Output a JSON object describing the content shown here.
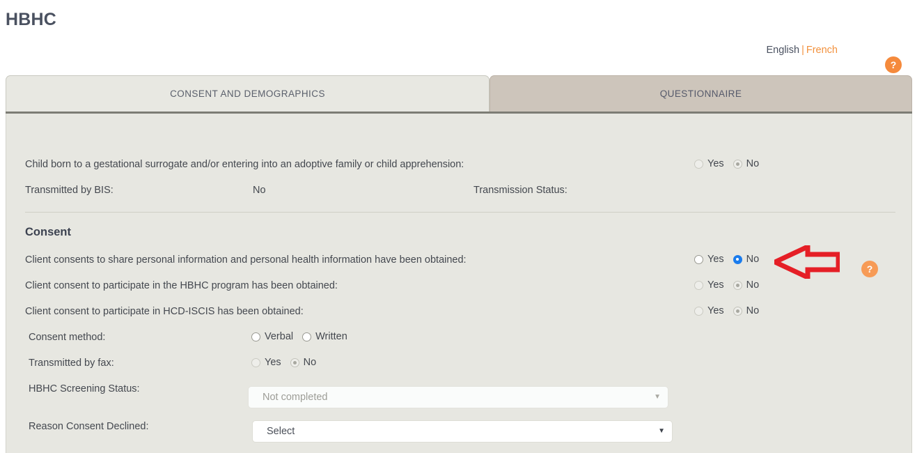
{
  "header": {
    "title": "HBHC",
    "help_icon": "?",
    "help_icon_name": "help-icon"
  },
  "language": {
    "english": "English",
    "separator": "|",
    "french": "French"
  },
  "tabs": [
    {
      "label": "CONSENT AND DEMOGRAPHICS",
      "active": false
    },
    {
      "label": "QUESTIONNAIRE",
      "active": true
    }
  ],
  "questionnaire": {
    "help_icon": "?",
    "surrogate": {
      "label": "Child born to a gestational surrogate and/or entering into an adoptive family or child apprehension:",
      "options": [
        "Yes",
        "No"
      ],
      "selected": "No",
      "enabled": false
    },
    "transmitted_by_bis": {
      "label": "Transmitted by BIS:",
      "value": "No"
    },
    "transmission_status": {
      "label": "Transmission Status:",
      "value": ""
    },
    "consent_section": {
      "heading": "Consent",
      "rows": [
        {
          "label": "Client consents to share personal information and personal health information have been obtained:",
          "options": [
            "Yes",
            "No"
          ],
          "selected": "No",
          "enabled": true
        },
        {
          "label": "Client consent to participate in the HBHC program has been obtained:",
          "options": [
            "Yes",
            "No"
          ],
          "selected": "No",
          "enabled": false
        },
        {
          "label": "Client consent to participate in HCD-ISCIS has been obtained:",
          "options": [
            "Yes",
            "No"
          ],
          "selected": "No",
          "enabled": false
        }
      ],
      "consent_method": {
        "label": "Consent method:",
        "options": [
          "Verbal",
          "Written"
        ],
        "selected": "",
        "enabled": true
      },
      "transmitted_by_fax": {
        "label": "Transmitted by fax:",
        "options": [
          "Yes",
          "No"
        ],
        "selected": "No",
        "enabled": false
      },
      "screening_status": {
        "label": "HBHC Screening Status:",
        "value": "Not completed",
        "caret": "▼",
        "enabled": false
      },
      "reason_consent_declined": {
        "label": "Reason Consent Declined:",
        "value": "Select",
        "caret": "▼",
        "enabled": true
      }
    }
  },
  "annotation": {
    "arrow_color": "#e51f26",
    "points_to": "consent-share-info-radio-group"
  }
}
